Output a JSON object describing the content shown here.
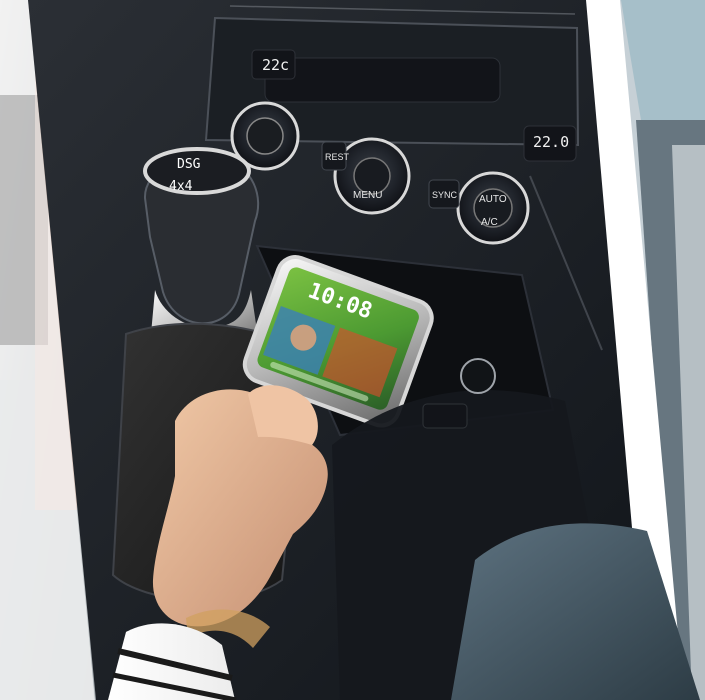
{
  "climate": {
    "left_temp": "22c",
    "right_temp": "22.0",
    "buttons": {
      "rest": "REST",
      "menu": "MENU",
      "sync": "SYNC",
      "auto": "AUTO",
      "ac": "A/C"
    }
  },
  "shifter": {
    "top_text": "DSG",
    "bottom_text": "4x4"
  },
  "phone": {
    "time": "10:08"
  }
}
